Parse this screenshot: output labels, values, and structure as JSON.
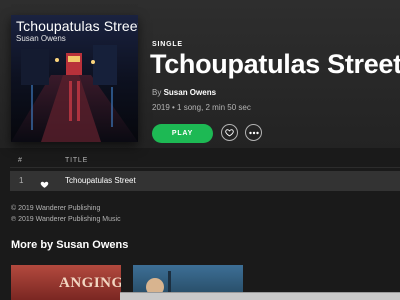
{
  "album": {
    "cover_title": "Tchoupatulas Street",
    "cover_artist": "Susan Owens",
    "type": "SINGLE",
    "title": "Tchoupatulas Street",
    "by_prefix": "By",
    "artist": "Susan Owens",
    "meta": "2019 • 1 song, 2 min 50 sec"
  },
  "actions": {
    "play_label": "PLAY",
    "like_icon": "heart-outline-icon",
    "more_icon": "more-dots-icon"
  },
  "tracklist": {
    "col_number": "#",
    "col_title": "TITLE",
    "tracks": [
      {
        "number": "1",
        "title": "Tchoupatulas Street",
        "liked": true
      }
    ]
  },
  "copyrights": [
    "© 2019 Wanderer Publishing",
    "℗ 2019 Wanderer Publishing Music"
  ],
  "more_by": {
    "heading": "More by Susan Owens",
    "albums": [
      {
        "cover_text": "ANGING"
      },
      {
        "cover_text": ""
      }
    ]
  },
  "colors": {
    "accent": "#1db954",
    "background": "#1a1a1a",
    "row_highlight": "#333333"
  }
}
